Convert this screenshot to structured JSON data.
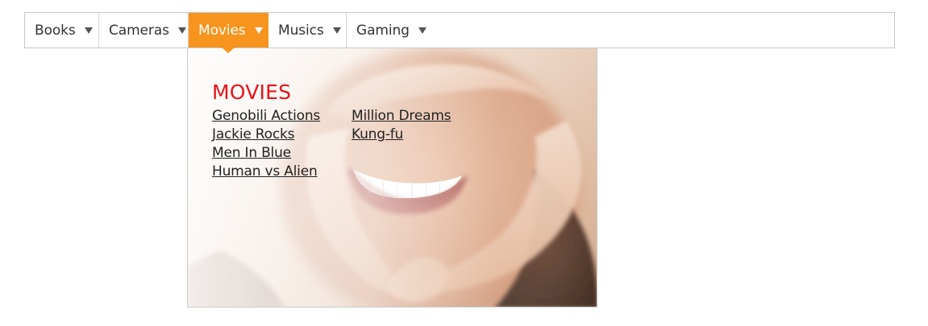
{
  "menu": {
    "items": [
      {
        "label": "Books"
      },
      {
        "label": "Cameras"
      },
      {
        "label": "Movies"
      },
      {
        "label": "Musics"
      },
      {
        "label": "Gaming"
      }
    ],
    "active_label": "Movies",
    "accent_color": "#f7941d"
  },
  "dropdown": {
    "heading": "MOVIES",
    "heading_color": "#e8141b",
    "columns": [
      {
        "links": [
          "Genobili Actions",
          "Jackie Rocks",
          "Men In Blue",
          "Human vs Alien"
        ]
      },
      {
        "links": [
          "Million Dreams",
          "Kung-fu"
        ]
      }
    ],
    "background": "photo-heart-hands-smile"
  }
}
